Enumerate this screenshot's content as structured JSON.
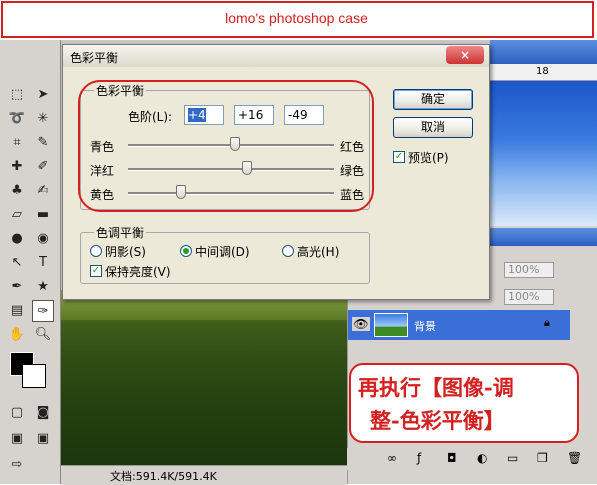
{
  "banner": {
    "text": "lomo's photoshop case"
  },
  "dialog": {
    "title": "色彩平衡",
    "close_label": "×",
    "color_balance_group": "色彩平衡",
    "levels_label": "色阶(L):",
    "levels": [
      "+4",
      "+16",
      "-49"
    ],
    "sliders": [
      {
        "left": "青色",
        "right": "红色",
        "value": 4
      },
      {
        "left": "洋红",
        "right": "绿色",
        "value": 16
      },
      {
        "left": "黄色",
        "right": "蓝色",
        "value": -49
      }
    ],
    "tone_group": "色调平衡",
    "tones": [
      {
        "label": "阴影(S)",
        "selected": false
      },
      {
        "label": "中间调(D)",
        "selected": true
      },
      {
        "label": "高光(H)",
        "selected": false
      }
    ],
    "preserve_luminosity": {
      "label": "保持亮度(V)",
      "checked": true
    },
    "ok_label": "确定",
    "cancel_label": "取消",
    "preview": {
      "label": "预览(P)",
      "checked": true
    }
  },
  "ruler": {
    "mark": "18"
  },
  "layers": {
    "opacity": "100%",
    "fill": "100%",
    "layer_name": "背景"
  },
  "status": {
    "doc_size": "文档:591.4K/591.4K"
  },
  "note": {
    "line1": "再执行【图像-调",
    "line2": "整-色彩平衡】"
  },
  "colors": {
    "accent_red": "#d42020",
    "xp_blue": "#316ac5"
  }
}
